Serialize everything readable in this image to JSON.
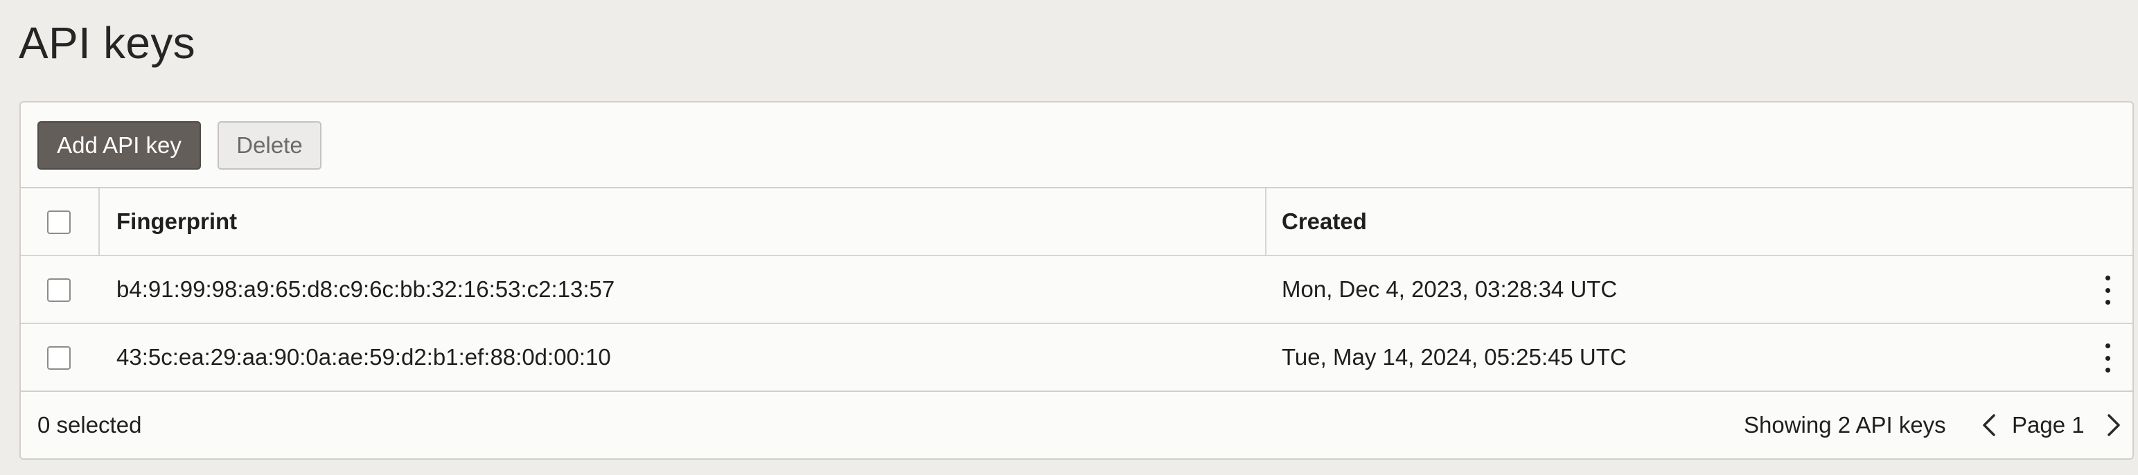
{
  "page": {
    "title": "API keys"
  },
  "toolbar": {
    "add_label": "Add API key",
    "delete_label": "Delete"
  },
  "table": {
    "columns": [
      "Fingerprint",
      "Created"
    ],
    "rows": [
      {
        "fingerprint": "b4:91:99:98:a9:65:d8:c9:6c:bb:32:16:53:c2:13:57",
        "created": "Mon, Dec 4, 2023, 03:28:34 UTC",
        "checked": false
      },
      {
        "fingerprint": "43:5c:ea:29:aa:90:0a:ae:59:d2:b1:ef:88:0d:00:10",
        "created": "Tue, May 14, 2024, 05:25:45 UTC",
        "checked": false
      }
    ]
  },
  "footer": {
    "selected": "0 selected",
    "showing": "Showing 2 API keys",
    "page_label": "Page 1"
  },
  "icons": {
    "row_menu": "more-vertical-icon",
    "prev": "chevron-left-icon",
    "next": "chevron-right-icon"
  },
  "colors": {
    "page_background": "#efedea",
    "primary_button": "#645e5a",
    "panel_background": "#fbfbfa"
  }
}
